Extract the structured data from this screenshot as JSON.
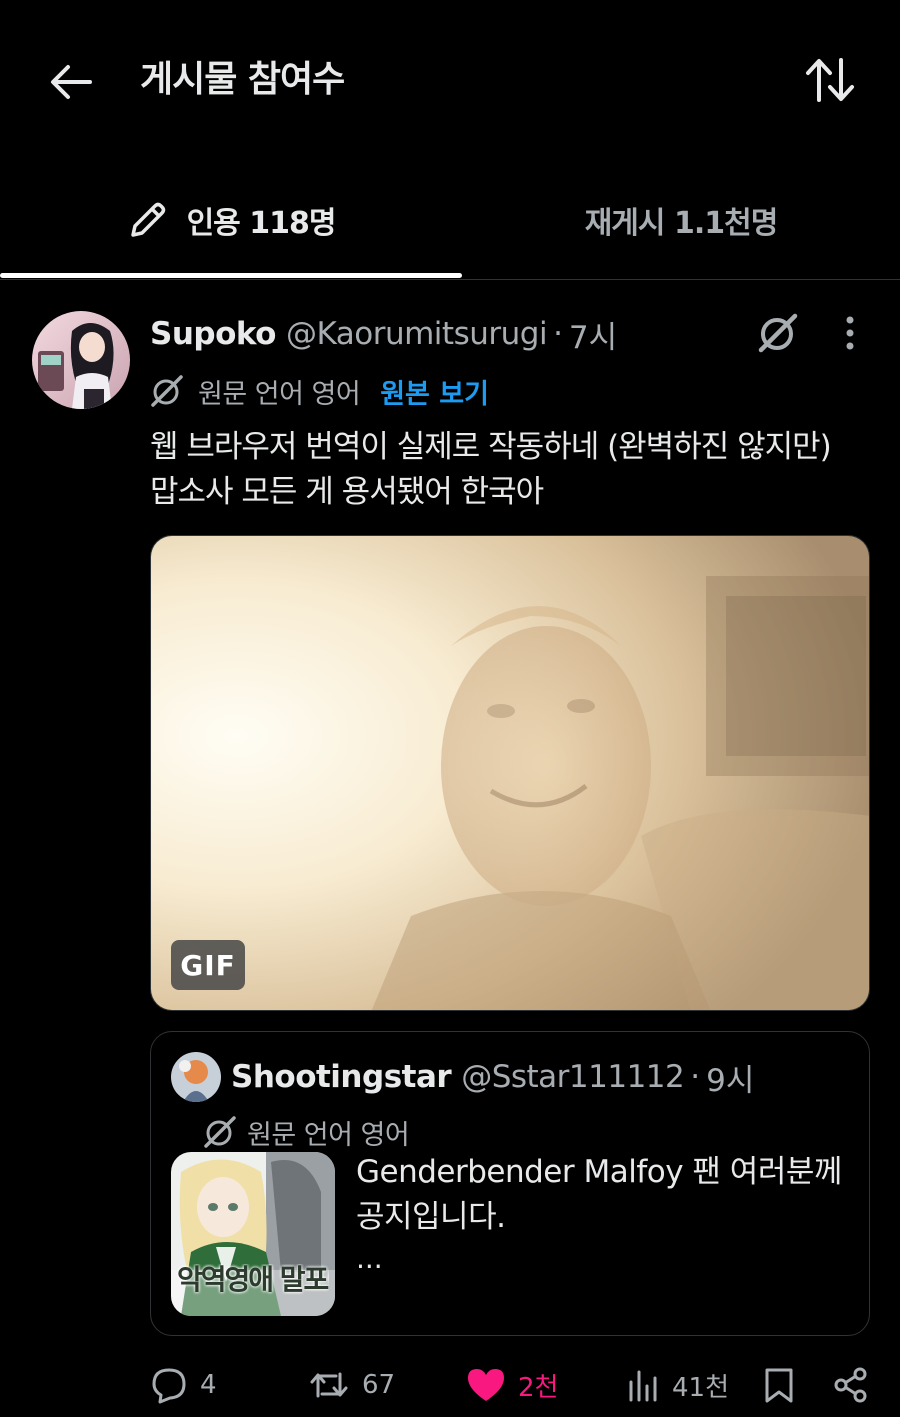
{
  "header": {
    "back_icon": "arrow-left-icon",
    "title": "게시물 참여수",
    "sort_icon": "sort-arrows-icon"
  },
  "tabs": [
    {
      "label": "인용 118명",
      "icon": "pencil-icon",
      "active": true
    },
    {
      "label": "재게시 1.1천명",
      "active": false
    }
  ],
  "post": {
    "author": {
      "display_name": "Supoko",
      "handle": "@Kaorumitsurugi",
      "separator": "·",
      "time": "7시"
    },
    "translation": {
      "label": "원문 언어 영어",
      "show_original": "원본 보기"
    },
    "text": "웹 브라우저 번역이 실제로 작동하네 (완벽하진 않지만)\n맙소사 모든 게 용서됐어 한국아",
    "media": {
      "type": "gif",
      "badge": "GIF"
    },
    "quote": {
      "display_name": "Shootingstar",
      "handle": "@Sstar111112",
      "separator": "·",
      "time": "9시",
      "translation_label": "원문 언어 영어",
      "text": "Genderbender Malfoy 팬 여러분께\n공지입니다.",
      "ellipsis": "...",
      "thumbnail_caption": "악역영애 말포이"
    },
    "actions": {
      "replies": "4",
      "reposts": "67",
      "likes": "2천",
      "views": "41천"
    }
  },
  "colors": {
    "background": "#000000",
    "text_primary": "#e7e9ea",
    "text_secondary": "#a8adb2",
    "link": "#1d9bf0",
    "like": "#f91880",
    "border": "#2f3336"
  }
}
